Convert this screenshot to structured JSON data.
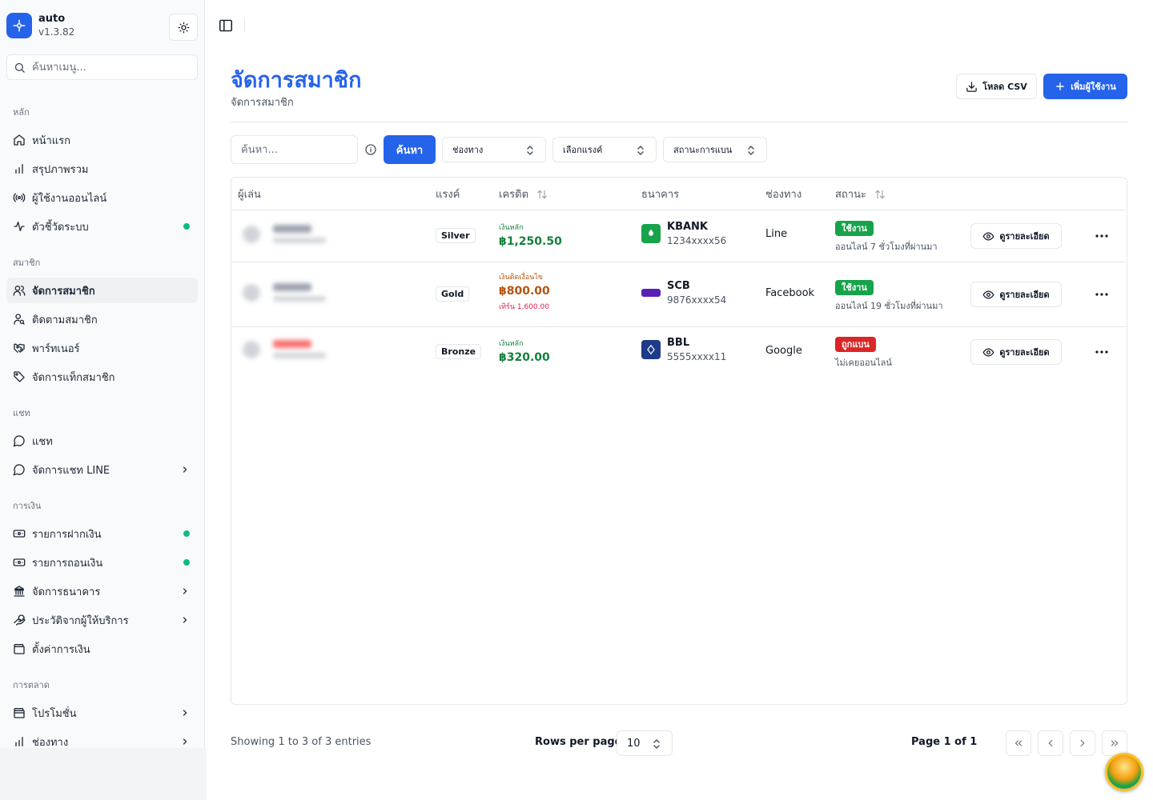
{
  "app": {
    "name": "auto",
    "version": "v1.3.82"
  },
  "sidebar": {
    "search_placeholder": "ค้นหาเมนู...",
    "sections": [
      {
        "label": "หลัก",
        "items": [
          {
            "label": "หน้าแรก",
            "icon": "home-icon"
          },
          {
            "label": "สรุปภาพรวม",
            "icon": "bar-chart-icon"
          },
          {
            "label": "ผู้ใช้งานออนไลน์",
            "icon": "radio-icon"
          },
          {
            "label": "ตัวชี้วัดระบบ",
            "icon": "activity-icon",
            "indicator": true
          }
        ]
      },
      {
        "label": "สมาชิก",
        "items": [
          {
            "label": "จัดการสมาชิก",
            "icon": "users-icon",
            "active": true
          },
          {
            "label": "ติดตามสมาชิก",
            "icon": "user-search-icon"
          },
          {
            "label": "พาร์ทเนอร์",
            "icon": "handshake-icon"
          },
          {
            "label": "จัดการแท็กสมาชิก",
            "icon": "tag-icon"
          }
        ]
      },
      {
        "label": "แชท",
        "items": [
          {
            "label": "แชท",
            "icon": "chat-icon"
          },
          {
            "label": "จัดการแชท LINE",
            "icon": "chat-icon",
            "expandable": true
          }
        ]
      },
      {
        "label": "การเงิน",
        "items": [
          {
            "label": "รายการฝากเงิน",
            "icon": "deposit-icon",
            "indicator": true
          },
          {
            "label": "รายการถอนเงิน",
            "icon": "withdraw-icon",
            "indicator": true
          },
          {
            "label": "จัดการธนาคาร",
            "icon": "bank-icon",
            "expandable": true
          },
          {
            "label": "ประวัติจากผู้ให้บริการ",
            "icon": "hand-coins-icon",
            "expandable": true
          },
          {
            "label": "ตั้งค่าการเงิน",
            "icon": "wallet-icon"
          }
        ]
      },
      {
        "label": "การตลาด",
        "items": [
          {
            "label": "โปรโมชั่น",
            "icon": "wallet-icon",
            "expandable": true
          },
          {
            "label": "ช่องทาง",
            "icon": "bar-chart-icon",
            "expandable": true
          }
        ]
      }
    ]
  },
  "header": {
    "title": "จัดการสมาชิก",
    "subtitle": "จัดการสมาชิก",
    "csv_label": "โหลด CSV",
    "add_label": "เพิ่มผู้ใช้งาน"
  },
  "filters": {
    "search_placeholder": "ค้นหา...",
    "search_button": "ค้นหา",
    "channel": "ช่องทาง",
    "rank": "เลือกแรงค์",
    "ban_status": "สถานะการแบน"
  },
  "table": {
    "columns": {
      "player": "ผู้เล่น",
      "rank": "แรงค์",
      "credit": "เครดิต",
      "bank": "ธนาคาร",
      "channel": "ช่องทาง",
      "status": "สถานะ"
    },
    "detail_label": "ดูรายละเอียด",
    "rows": [
      {
        "rank": "Silver",
        "credit_type": "เงินหลัก",
        "credit_color": "#15803d",
        "credit_value": "฿1,250.50",
        "bank_name": "KBANK",
        "bank_account": "1234xxxx56",
        "bank_color": "#16a34a",
        "channel": "Line",
        "status": "ใช้งาน",
        "status_kind": "active",
        "last_online": "ออนไลน์ 7 ชั่วโมงที่ผ่านมา"
      },
      {
        "rank": "Gold",
        "credit_type": "เงินติดเงื่อนไข",
        "credit_color": "#b45309",
        "credit_value": "฿800.00",
        "credit_extra": "เทิร์น 1,600.00",
        "bank_name": "SCB",
        "bank_account": "9876xxxx54",
        "bank_color": "#5b21b6",
        "channel": "Facebook",
        "status": "ใช้งาน",
        "status_kind": "active",
        "last_online": "ออนไลน์ 19 ชั่วโมงที่ผ่านมา"
      },
      {
        "rank": "Bronze",
        "credit_type": "เงินหลัก",
        "credit_color": "#15803d",
        "credit_value": "฿320.00",
        "bank_name": "BBL",
        "bank_account": "5555xxxx11",
        "bank_color": "#1e3a8a",
        "channel": "Google",
        "status": "ถูกแบน",
        "status_kind": "banned",
        "last_online": "ไม่เคยออนไลน์"
      }
    ]
  },
  "footer": {
    "showing": "Showing 1 to 3 of 3 entries",
    "rows_per_page_label": "Rows per page",
    "rows_per_page": "10",
    "page_info": "Page 1 of 1"
  },
  "colors": {
    "primary": "#2563eb",
    "active_badge": "#16a34a",
    "banned_badge": "#dc2626",
    "indicator": "#10b981"
  }
}
